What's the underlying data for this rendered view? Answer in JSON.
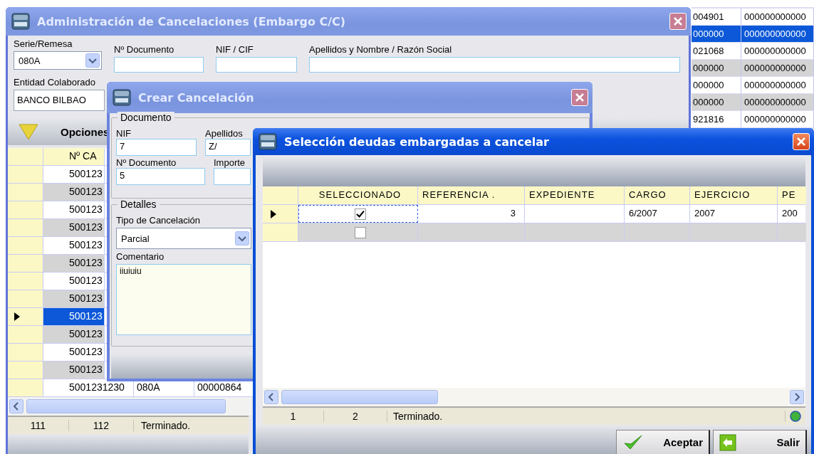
{
  "background_window": {
    "rows": [
      {
        "cells": [
          "004901",
          "000000000000"
        ],
        "selected": false
      },
      {
        "cells": [
          "000000",
          "000000000000"
        ],
        "selected": true
      },
      {
        "cells": [
          "021068",
          "000000000000"
        ],
        "selected": false
      },
      {
        "cells": [
          "000000",
          "000000000000"
        ],
        "selected": false
      },
      {
        "cells": [
          "000000",
          "000000000000"
        ],
        "selected": false
      },
      {
        "cells": [
          "000000",
          "000000000000"
        ],
        "selected": false
      },
      {
        "cells": [
          "921816",
          "000000000000"
        ],
        "selected": false
      }
    ]
  },
  "main_window": {
    "title": "Administración de Cancelaciones (Embargo C/C)",
    "active": false,
    "filters": [
      {
        "kind": "combo",
        "label": "Serie/Remesa",
        "value": "080A"
      },
      {
        "kind": "text",
        "label": "Nº Documento"
      },
      {
        "kind": "text",
        "label": "NIF / CIF"
      },
      {
        "kind": "text",
        "label": "Apellidos y Nombre / Razón Social"
      }
    ],
    "entity": {
      "label": "Entidad Colaborado",
      "value": "BANCO BILBAO"
    },
    "options": "Opciones",
    "grid": {
      "columns": [
        "Nº CA"
      ],
      "rows": [
        {
          "cells": [
            "500123"
          ],
          "selected": false
        },
        {
          "cells": [
            "500123"
          ],
          "selected": false
        },
        {
          "cells": [
            "500123"
          ],
          "selected": false
        },
        {
          "cells": [
            "500123"
          ],
          "selected": false
        },
        {
          "cells": [
            "500123"
          ],
          "selected": false
        },
        {
          "cells": [
            "500123"
          ],
          "selected": false
        },
        {
          "cells": [
            "500123"
          ],
          "selected": false
        },
        {
          "cells": [
            "500123"
          ],
          "selected": false
        },
        {
          "cells": [
            "500123"
          ],
          "selected": true
        },
        {
          "cells": [
            "500123"
          ],
          "selected": false
        },
        {
          "cells": [
            "500123"
          ],
          "selected": false
        },
        {
          "cells": [
            "500123"
          ],
          "selected": false
        },
        {
          "cells": [
            "5001231230",
            "080A",
            "00000864"
          ],
          "selected": false
        }
      ]
    },
    "status_bar": [
      "111",
      "112",
      "Terminado."
    ]
  },
  "create_window": {
    "title": "Crear Cancelación",
    "active": false,
    "document_group": "Documento",
    "fields": [
      {
        "label": "NIF",
        "value": "7"
      },
      {
        "label": "Apellidos",
        "value": "Z/"
      },
      {
        "label": "Nº Documento",
        "value": "5"
      },
      {
        "label": "Importe"
      }
    ],
    "details_group": "Detalles",
    "type_label": "Tipo de Cancelación",
    "type_value": "Parcial",
    "comment_label": "Comentario",
    "comment": "iiuiuiu"
  },
  "selection_window": {
    "title": "Selección deudas embargadas a cancelar",
    "active": true,
    "columns": [
      "SELECCIONADO",
      "REFERENCIA .",
      "EXPEDIENTE",
      "CARGO",
      "EJERCICIO",
      "PE"
    ],
    "rows": [
      {
        "selected": true,
        "checked": true,
        "reference": "3",
        "cargo": "6/2007",
        "ejercicio": "2007",
        "column_6": "200"
      },
      {
        "selected": false,
        "checked": false
      }
    ],
    "status_bar": [
      "1",
      "2",
      "Terminado."
    ],
    "buttons": [
      {
        "kind": "accept",
        "label": "Aceptar"
      },
      {
        "kind": "exit",
        "label": "Salir"
      }
    ]
  }
}
